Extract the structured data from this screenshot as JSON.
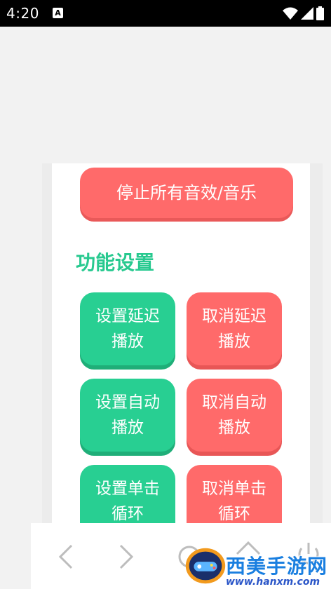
{
  "status_bar": {
    "time": "4:20",
    "notification_badge": "A"
  },
  "main": {
    "stop_all_button": "停止所有音效/音乐",
    "section_title": "功能设置",
    "buttons": [
      {
        "line1": "设置延迟",
        "line2": "播放"
      },
      {
        "line1": "取消延迟",
        "line2": "播放"
      },
      {
        "line1": "设置自动",
        "line2": "播放"
      },
      {
        "line1": "取消自动",
        "line2": "播放"
      },
      {
        "line1": "设置单击",
        "line2": "循环"
      },
      {
        "line1": "取消单击",
        "line2": "循环"
      }
    ]
  },
  "watermark": {
    "text": "西美手游网",
    "url": "www.hanxm.com"
  },
  "colors": {
    "green": "#28cf92",
    "red": "#ff6a6a",
    "title_green": "#27c98f"
  }
}
